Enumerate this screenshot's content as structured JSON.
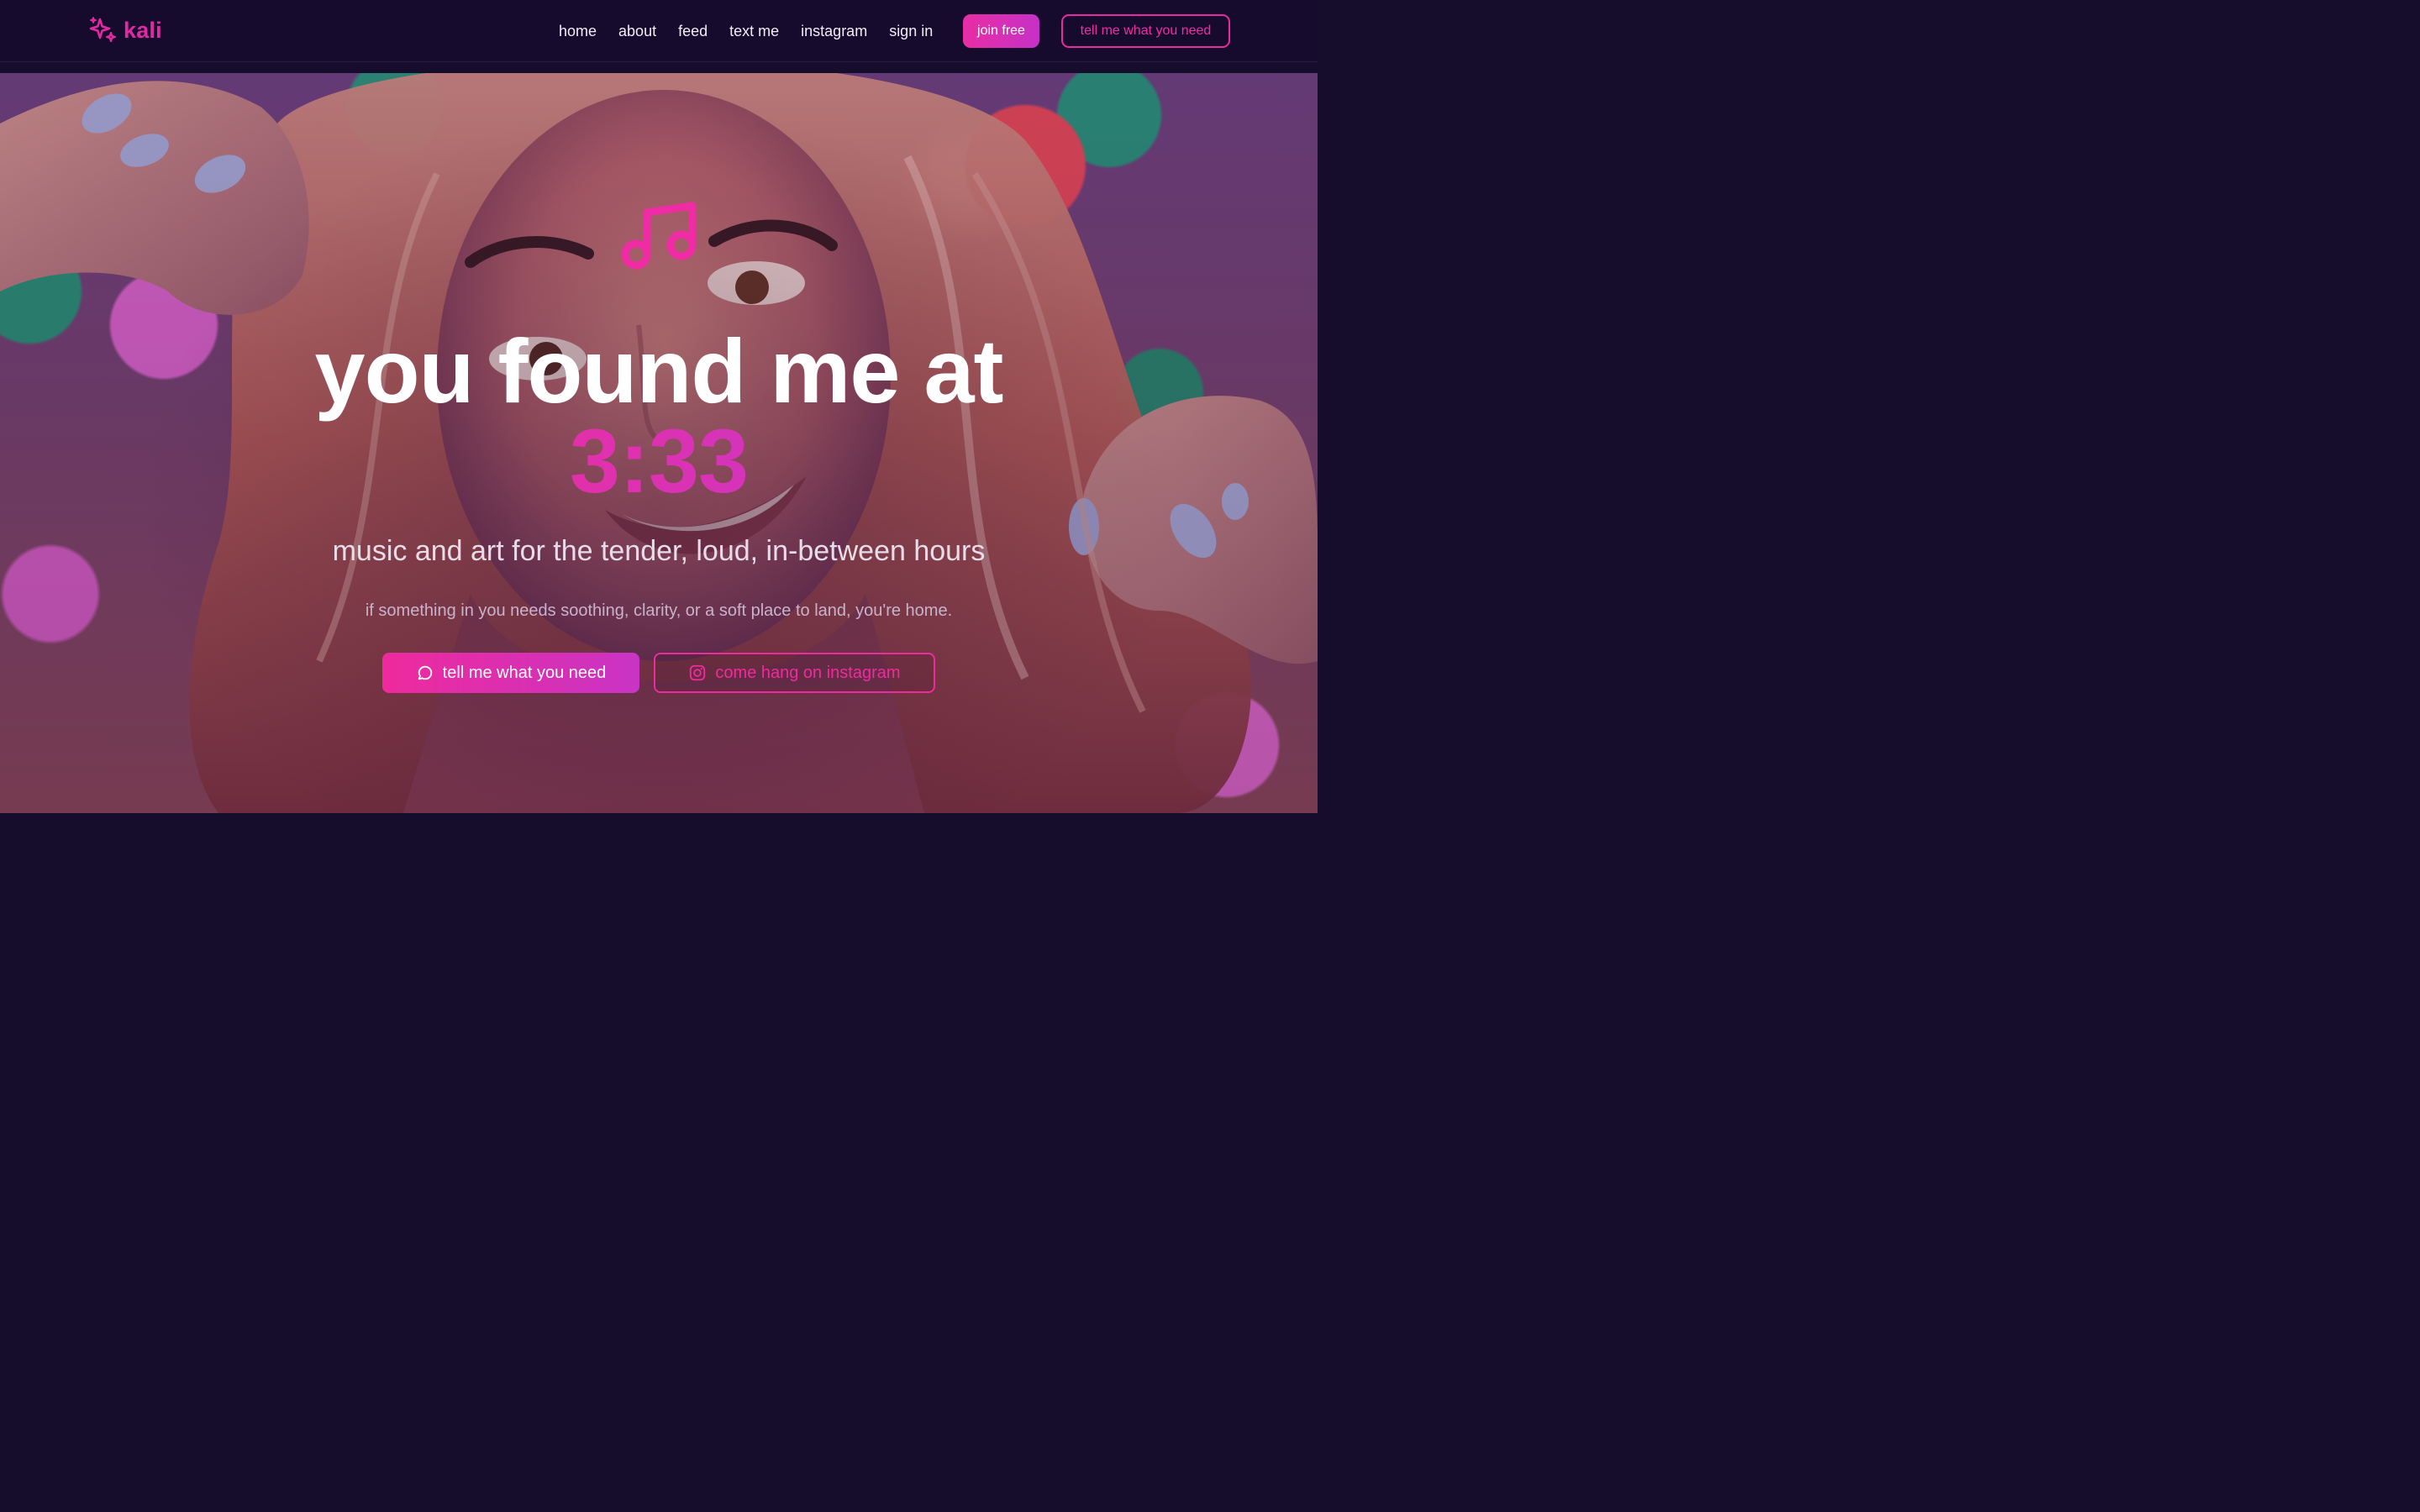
{
  "brand": {
    "name": "kali",
    "icon": "sparkles-icon"
  },
  "nav": {
    "links": [
      "home",
      "about",
      "feed",
      "text me",
      "instagram",
      "sign in"
    ],
    "join_label": "join free",
    "cta_label": "tell me what you need"
  },
  "hero": {
    "icon": "music-note-icon",
    "headline": "you found me at",
    "headline_accent": "3:33",
    "subheading": "music and art for the tender, loud, in-between hours",
    "tagline": "if something in you needs soothing, clarity, or a soft place to land, you're home.",
    "primary_cta": {
      "label": "tell me what you need",
      "icon": "message-bubble-icon"
    },
    "secondary_cta": {
      "label": "come hang on instagram",
      "icon": "instagram-icon"
    }
  },
  "colors": {
    "background": "#170b2d",
    "accent": "#e82ea4",
    "accent_purple": "#c631c7",
    "text": "#ffffff"
  }
}
